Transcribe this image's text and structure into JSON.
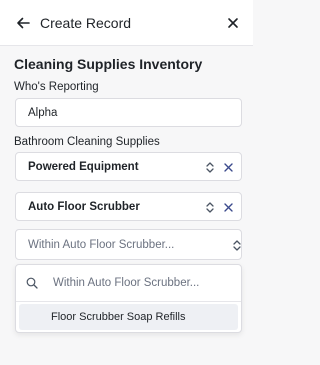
{
  "header": {
    "title": "Create Record",
    "back_icon": "arrow-left-icon",
    "close_icon": "close-icon"
  },
  "form": {
    "title": "Cleaning Supplies Inventory",
    "reporter": {
      "label": "Who's Reporting",
      "value": "Alpha"
    },
    "bathroom": {
      "label": "Bathroom Cleaning Supplies",
      "levels": [
        {
          "value": "Powered Equipment"
        },
        {
          "value": "Auto Floor Scrubber"
        },
        {
          "placeholder": "Within Auto Floor Scrubber..."
        }
      ]
    }
  },
  "dropdown": {
    "search_placeholder": "Within Auto Floor Scrubber...",
    "search_icon": "search-icon",
    "options": [
      {
        "label": "Floor Scrubber Soap Refills"
      }
    ]
  },
  "colors": {
    "background": "#f7f7f8",
    "surface": "#ffffff",
    "border": "#dcdce1",
    "text": "#1f2328",
    "muted_text": "#6b7280",
    "clear_icon": "#3b4a8c",
    "option_highlight": "#eef0f4"
  }
}
